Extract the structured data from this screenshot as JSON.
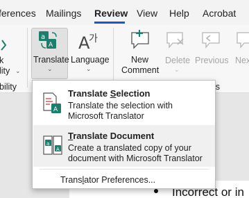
{
  "tabs": {
    "references": "ferences",
    "mailings": "Mailings",
    "review": "Review",
    "view": "View",
    "help": "Help",
    "acrobat": "Acrobat"
  },
  "ribbon": {
    "accessibility_label_1": "k",
    "accessibility_label_2": "lity",
    "accessibility_group": "bility",
    "translate_label": "Translate",
    "language_label": "Language",
    "new_comment_line1": "New",
    "new_comment_line2": "Comment",
    "delete_label": "Delete",
    "previous_label": "Previous",
    "next_label": "Nex",
    "comments_group": "ments"
  },
  "menu": {
    "translate_selection": {
      "title_pre": "Translate ",
      "title_key": "S",
      "title_post": "election",
      "desc": "Translate the selection with Microsoft Translator"
    },
    "translate_document": {
      "title_key": "T",
      "title_post": "ranslate Document",
      "desc": "Create a translated copy of your document with Microsoft Translator"
    },
    "preferences": {
      "pre": "Trans",
      "key": "l",
      "post": "ator Preferences..."
    }
  },
  "document": {
    "bullet_text": "Incorrect or in"
  },
  "colors": {
    "accent": "#185abd",
    "icon_teal": "#1e7d6c",
    "icon_red": "#c43e3e"
  }
}
